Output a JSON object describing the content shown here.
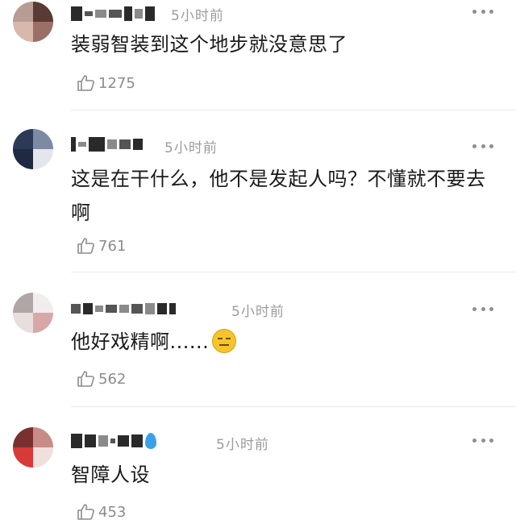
{
  "time_label": "5小时前",
  "comments": [
    {
      "text": "装弱智装到这个地步就没意思了",
      "likes": "1275"
    },
    {
      "text": "这是在干什么，他不是发起人吗？不懂就不要去啊",
      "likes": "761"
    },
    {
      "text": "他好戏精啊......",
      "likes": "562"
    },
    {
      "text": "智障人设",
      "likes": "453"
    }
  ],
  "icons": {
    "like": "thumbs-up-icon",
    "more": "more-dots-icon",
    "emoji": "expressionless-face-icon",
    "badge": "water-drop-icon"
  },
  "colors": {
    "meta": "#9c9c9c",
    "text": "#1a1a1a",
    "divider": "#e9e9e9",
    "emoji": "#f7c52b",
    "drop": "#3aa0ea"
  }
}
